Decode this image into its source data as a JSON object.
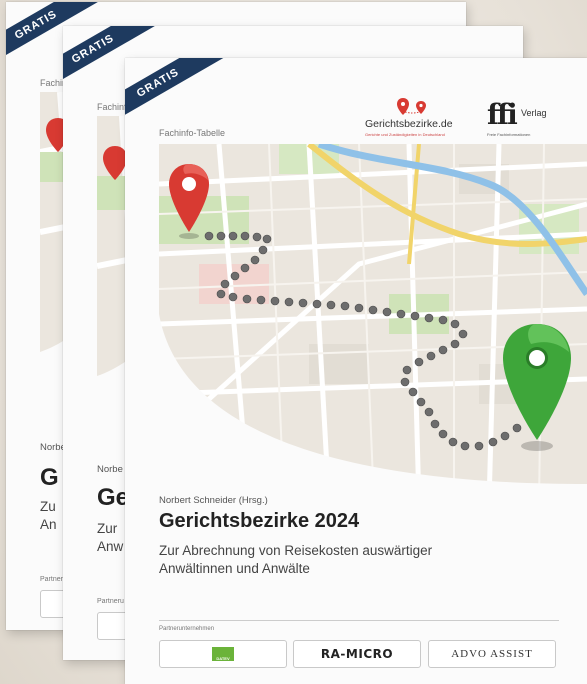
{
  "badge": "GRATIS",
  "series_label": "Fachinfo-Tabelle",
  "logos": {
    "gerichtsbezirke": "Gerichtsbezirke.de",
    "gerichtsbezirke_tagline": "Gerichte und Zuständigkeiten in Deutschland",
    "verlag_mark": "ffi",
    "verlag_name": "Verlag",
    "verlag_tagline": "Freie Fachinformationen"
  },
  "author": "Norbert Schneider (Hrsg.)",
  "author_short": "Norbe",
  "title": "Gerichtsbezirke 2024",
  "title_short_1": "Ge",
  "title_short_2": "G",
  "subtitle_line1": "Zur Abrechnung von Reisekosten auswärtiger",
  "subtitle_line2": "Anwältinnen und Anwälte",
  "subtitle_short_1a": "Zur",
  "subtitle_short_1b": "Anw",
  "subtitle_short_2a": "Zu",
  "subtitle_short_2b": "An",
  "partner_label": "Partnerunternehmen",
  "partner_label_short": "Partneru",
  "partners": [
    "DATEV",
    "RA-MICRO",
    "ADVO ASSIST"
  ],
  "colors": {
    "ribbon": "#1e3a5f",
    "pin_start": "#d83a32",
    "pin_end": "#3ea63a",
    "river": "#8fc1e8",
    "road_yellow": "#f1d46a"
  }
}
